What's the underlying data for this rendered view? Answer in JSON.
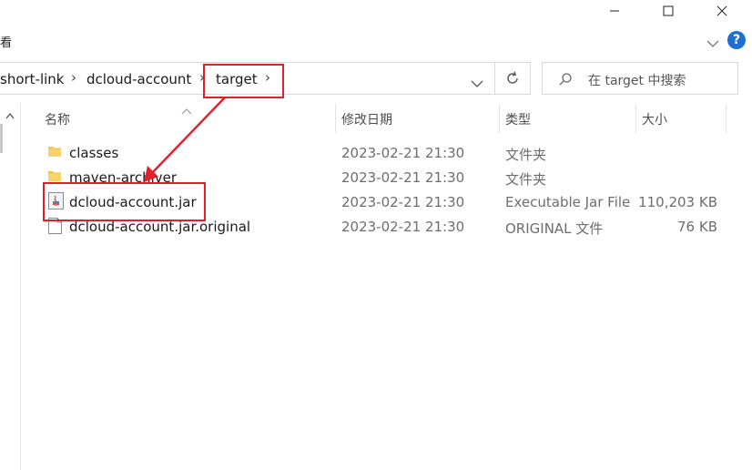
{
  "window": {
    "minimize_icon": "minimize-icon",
    "maximize_icon": "maximize-icon",
    "close_icon": "close-icon"
  },
  "ribbon": {
    "view_label": "看",
    "expand_icon": "chevron-down-icon",
    "help_label": "?"
  },
  "address": {
    "crumbs": [
      "short-link",
      "dcloud-account",
      "target"
    ],
    "separator": "›",
    "dropdown_icon": "chevron-down-icon",
    "refresh_icon": "refresh-icon"
  },
  "search": {
    "placeholder": "在 target 中搜索",
    "icon": "search-icon"
  },
  "columns": {
    "name": "名称",
    "date": "修改日期",
    "type": "类型",
    "size": "大小",
    "sort_icon": "sort-up-icon"
  },
  "files": [
    {
      "name": "classes",
      "date": "2023-02-21 21:30",
      "type": "文件夹",
      "size": "",
      "icon": "folder-icon"
    },
    {
      "name": "maven-archiver",
      "date": "2023-02-21 21:30",
      "type": "文件夹",
      "size": "",
      "icon": "folder-icon"
    },
    {
      "name": "dcloud-account.jar",
      "date": "2023-02-21 21:30",
      "type": "Executable Jar File",
      "size": "110,203 KB",
      "icon": "java-jar-icon"
    },
    {
      "name": "dcloud-account.jar.original",
      "date": "2023-02-21 21:30",
      "type": "ORIGINAL 文件",
      "size": "76 KB",
      "icon": "file-icon"
    }
  ],
  "colors": {
    "highlight": "#e3202a",
    "folder": "#f4c342",
    "help": "#1f6fd1"
  }
}
